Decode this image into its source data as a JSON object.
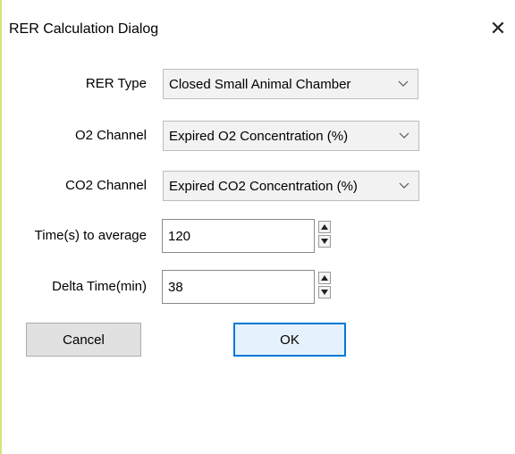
{
  "dialog": {
    "title": "RER Calculation Dialog",
    "close_glyph": "✕"
  },
  "rer_type": {
    "label": "RER Type",
    "value": "Closed Small Animal Chamber"
  },
  "o2_channel": {
    "label": "O2 Channel",
    "value": "Expired O2 Concentration (%)"
  },
  "co2_channel": {
    "label": "CO2 Channel",
    "value": "Expired CO2 Concentration (%)"
  },
  "time_to_average": {
    "label": "Time(s) to average",
    "value": "120"
  },
  "delta_time": {
    "label": "Delta Time(min)",
    "value": "38"
  },
  "buttons": {
    "cancel": "Cancel",
    "ok": "OK"
  },
  "icons": {
    "close": "close-icon",
    "dropdown": "chevron-down-icon",
    "spin_up": "arrow-up-icon",
    "spin_down": "arrow-down-icon"
  },
  "colors": {
    "ok_border": "#0078d7",
    "ok_background": "#e5f1fb",
    "left_accent": "#d7e37a"
  }
}
